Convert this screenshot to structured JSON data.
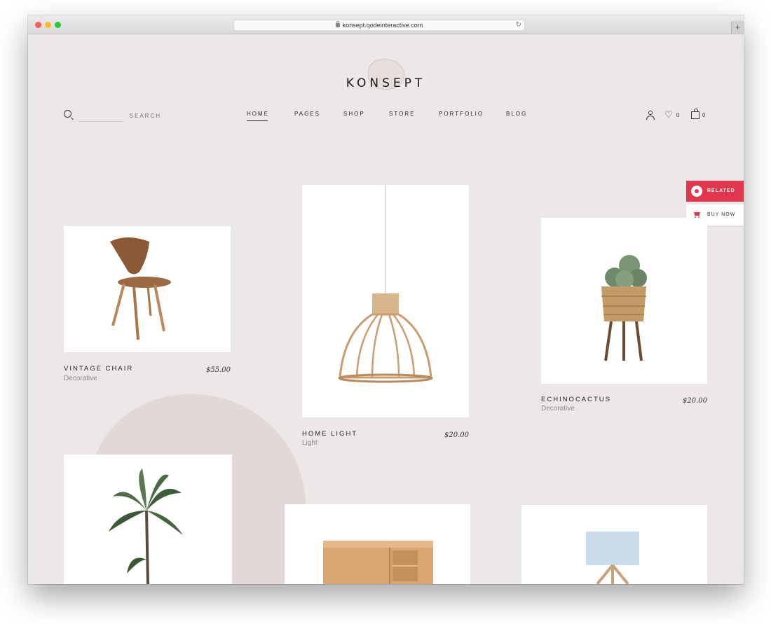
{
  "browser": {
    "url": "konsept.qodeinteractive.com"
  },
  "header": {
    "logo": "KONSEPT",
    "search_placeholder": "SEARCH",
    "nav": [
      "HOME",
      "PAGES",
      "SHOP",
      "STORE",
      "PORTFOLIO",
      "BLOG"
    ],
    "active_nav": "HOME",
    "wishlist_count": "0",
    "cart_count": "0"
  },
  "side_buttons": {
    "related": "RELATED",
    "buy_now": "BUY NOW"
  },
  "products": [
    {
      "name": "VINTAGE CHAIR",
      "category": "Decorative",
      "price": "$55.00",
      "image": "chair"
    },
    {
      "name": "HOME LIGHT",
      "category": "Light",
      "price": "$20.00",
      "image": "pendant-lamp"
    },
    {
      "name": "ECHINOCACTUS",
      "category": "Decorative",
      "price": "$20.00",
      "image": "cactus"
    }
  ],
  "partial_products": [
    {
      "image": "palm-plant"
    },
    {
      "image": "wooden-cabinet"
    },
    {
      "image": "table-lamp"
    }
  ],
  "colors": {
    "accent": "#e1374e",
    "background": "#ece8e7"
  }
}
